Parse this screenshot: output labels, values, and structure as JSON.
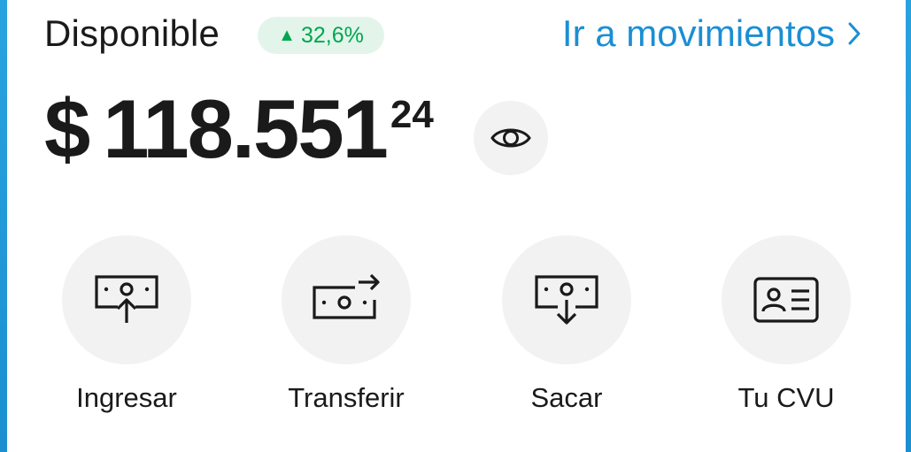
{
  "header": {
    "title": "Disponible",
    "badge": {
      "arrow": "▲",
      "value": "32,6%"
    },
    "link_label": "Ir a movimientos"
  },
  "balance": {
    "currency": "$",
    "integer": "118.551",
    "cents": "24"
  },
  "actions": [
    {
      "label": "Ingresar",
      "icon": "deposit-icon"
    },
    {
      "label": "Transferir",
      "icon": "transfer-icon"
    },
    {
      "label": "Sacar",
      "icon": "withdraw-icon"
    },
    {
      "label": "Tu CVU",
      "icon": "id-card-icon"
    }
  ],
  "colors": {
    "accent": "#1a8fd3",
    "positive": "#00a650",
    "positive_bg": "#e3f5ea",
    "circle_bg": "#f2f2f2",
    "text": "#1a1a1a"
  }
}
